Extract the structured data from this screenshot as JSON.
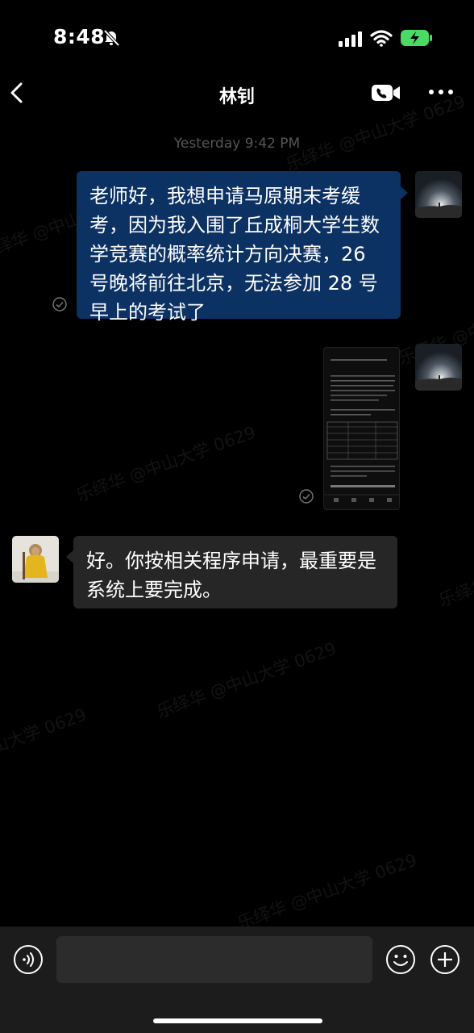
{
  "status_bar": {
    "time": "8:48"
  },
  "nav": {
    "title": "林钊"
  },
  "messages": {
    "timestamp": "Yesterday 9:42 PM",
    "outgoing_text": "老师好，我想申请马原期末考缓考，因为我入围了丘成桐大学生数学竞赛的概率统计方向决赛，26 号晚将前往北京，无法参加 28 号早上的考试了",
    "incoming_text": "好。你按相关程序申请，最重要是系统上要完成。"
  },
  "watermark": "乐绎华 @中山大学 0629",
  "colors": {
    "outgoing_bubble": "#0c3163",
    "incoming_bubble": "#262626",
    "background": "#000000",
    "battery_charging": "#4cd964"
  },
  "icons": [
    "back-icon",
    "video-call-icon",
    "more-icon",
    "bell-muted-icon",
    "signal-icon",
    "wifi-icon",
    "battery-charging-icon",
    "voice-icon",
    "emoji-icon",
    "plus-icon",
    "check-icon"
  ]
}
